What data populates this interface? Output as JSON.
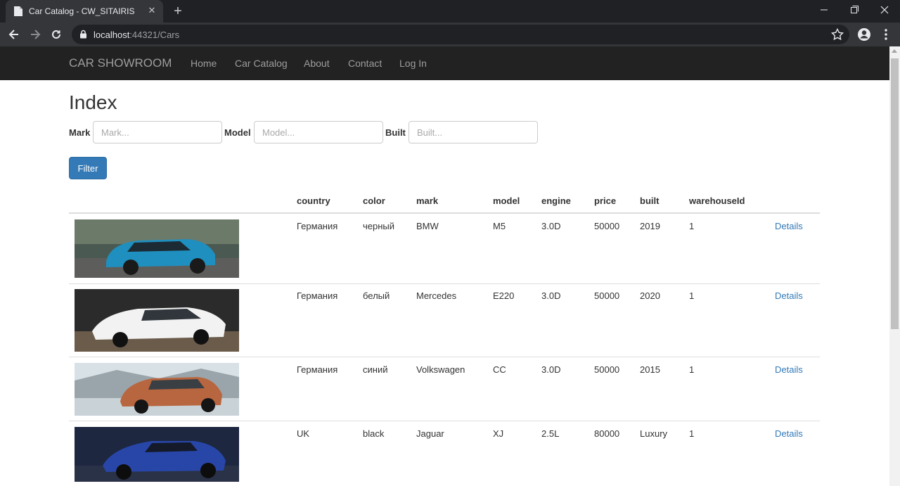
{
  "browser": {
    "tab_title": "Car Catalog - CW_SITAIRIS",
    "tab_close": "✕",
    "new_tab": "+",
    "url_host": "localhost",
    "url_rest": ":44321/Cars"
  },
  "navbar": {
    "brand": "CAR SHOWROOM",
    "links": [
      "Home",
      "Car Catalog",
      "About",
      "Contact",
      "Log In"
    ]
  },
  "page": {
    "title": "Index",
    "filters": {
      "mark_label": "Mark",
      "mark_placeholder": "Mark...",
      "model_label": "Model",
      "model_placeholder": "Model...",
      "built_label": "Built",
      "built_placeholder": "Built...",
      "button": "Filter"
    }
  },
  "table": {
    "headers": [
      "country",
      "color",
      "mark",
      "model",
      "engine",
      "price",
      "built",
      "warehouseId"
    ],
    "rows": [
      {
        "country": "Германия",
        "color": "черный",
        "mark": "BMW",
        "model": "M5",
        "engine": "3.0D",
        "price": "50000",
        "built": "2019",
        "warehouseId": "1",
        "details": "Details",
        "car_color": "#1f8fbf"
      },
      {
        "country": "Германия",
        "color": "белый",
        "mark": "Mercedes",
        "model": "E220",
        "engine": "3.0D",
        "price": "50000",
        "built": "2020",
        "warehouseId": "1",
        "details": "Details",
        "car_color": "#f2f2f2"
      },
      {
        "country": "Германия",
        "color": "синий",
        "mark": "Volkswagen",
        "model": "CC",
        "engine": "3.0D",
        "price": "50000",
        "built": "2015",
        "warehouseId": "1",
        "details": "Details",
        "car_color": "#b8663f"
      },
      {
        "country": "UK",
        "color": "black",
        "mark": "Jaguar",
        "model": "XJ",
        "engine": "2.5L",
        "price": "80000",
        "built": "Luxury",
        "warehouseId": "1",
        "details": "Details",
        "car_color": "#2846a8"
      }
    ]
  }
}
